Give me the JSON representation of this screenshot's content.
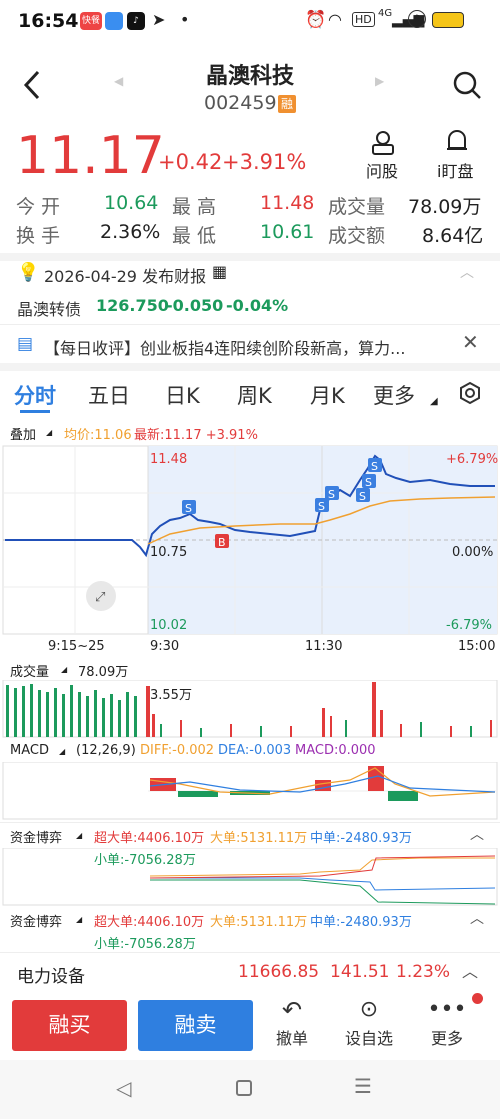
{
  "status": {
    "time": "16:54",
    "badge": "快餐",
    "hd": "HD",
    "net": "4G"
  },
  "header": {
    "title": "晶澳科技",
    "code": "002459",
    "rong": "融"
  },
  "quote": {
    "price": "11.17",
    "change": "+0.42",
    "pct": "+3.91%",
    "ask_label": "问股",
    "watch_label": "i盯盘"
  },
  "stats": [
    {
      "l": "今  开",
      "v": "10.64",
      "l2": "最  高",
      "v2": "11.48",
      "l3": "成交量",
      "v3": "78.09万"
    },
    {
      "l": "换  手",
      "v": "2.36%",
      "l2": "最  低",
      "v2": "10.61",
      "l3": "成交额",
      "v3": "8.64亿"
    }
  ],
  "notice": {
    "date": "2026-04-29 发布财报"
  },
  "bond": {
    "name": "晶澳转债",
    "price": "126.750",
    "chg": "-0.050",
    "pct": "-0.04%"
  },
  "news": {
    "text": "【每日收评】创业板指4连阳续创阶段新高，算力..."
  },
  "tabs": [
    "分时",
    "五日",
    "日K",
    "周K",
    "月K",
    "更多"
  ],
  "chart": {
    "overlay": "叠加",
    "avg": "均价:11.06",
    "latest": "最新:11.17 +3.91%",
    "yhigh": "11.48",
    "ymid": "10.75",
    "ylow": "10.02",
    "phigh": "+6.79%",
    "pmid": "0.00%",
    "plow": "-6.79%",
    "xlabels": [
      "9:15~25",
      "9:30",
      "11:30",
      "15:00"
    ]
  },
  "volume": {
    "label": "成交量",
    "total": "78.09万",
    "max": "3.55万"
  },
  "macd": {
    "label": "MACD",
    "params": "(12,26,9)",
    "diff": "DIFF:-0.002",
    "dea": "DEA:-0.003",
    "macd": "MACD:0.000"
  },
  "fund": {
    "label": "资金博弈",
    "xl": "超大单:4406.10万",
    "l": "大单:5131.11万",
    "m": "中单:-2480.93万",
    "s": "小单:-7056.28万"
  },
  "sector": {
    "name": "电力设备",
    "value": "11666.85",
    "chg": "141.51",
    "pct": "1.23%"
  },
  "bottom": {
    "buy": "融买",
    "sell": "融卖",
    "cancel": "撤单",
    "fav": "设自选",
    "more": "更多"
  },
  "colors": {
    "red": "#e23b3b",
    "green": "#1c9a5c",
    "blue": "#2f7fe0",
    "line": "#2150b8",
    "avg": "#f0a030"
  }
}
